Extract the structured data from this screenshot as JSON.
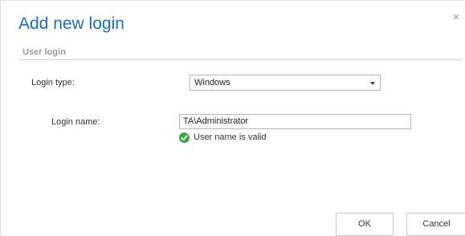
{
  "dialog": {
    "title": "Add new login",
    "close_glyph": "×"
  },
  "section": {
    "title": "User login"
  },
  "login_type": {
    "label": "Login type:",
    "selected": "Windows"
  },
  "login_name": {
    "label": "Login name:",
    "value": "TA\\Administrator",
    "validation_message": "User name is valid"
  },
  "buttons": {
    "ok": "OK",
    "cancel": "Cancel"
  },
  "colors": {
    "title": "#1b6fb5",
    "valid_check": "#3ca63c"
  },
  "icons": {
    "close": "close-icon",
    "dropdown": "chevron-down-icon",
    "validation": "check-circle-icon"
  }
}
